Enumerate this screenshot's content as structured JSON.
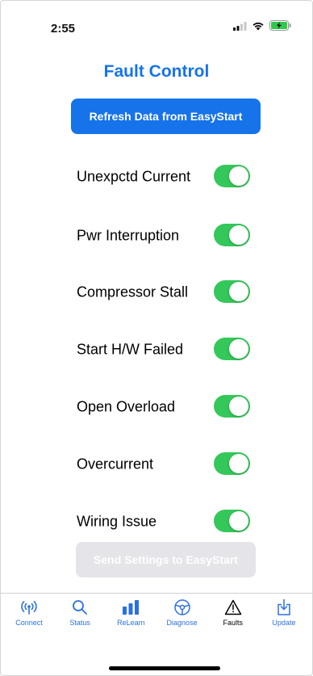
{
  "status_bar": {
    "time": "2:55",
    "icons": [
      "cellular-signal-icon",
      "wifi-icon",
      "battery-charging-icon"
    ],
    "battery_color": "#30c94a"
  },
  "title": "Fault Control",
  "colors": {
    "accent": "#1673ea",
    "toggle_on": "#34c759",
    "disabled_button": "#e4e4e9",
    "tab_inactive": "#2a70e0",
    "tab_active": "#000000"
  },
  "refresh_button": {
    "label": "Refresh Data from EasyStart"
  },
  "faults": [
    {
      "label": "Unexpctd Current",
      "enabled": true
    },
    {
      "label": "Pwr Interruption",
      "enabled": true
    },
    {
      "label": "Compressor Stall",
      "enabled": true
    },
    {
      "label": "Start H/W Failed",
      "enabled": true
    },
    {
      "label": "Open Overload",
      "enabled": true
    },
    {
      "label": "Overcurrent",
      "enabled": true
    },
    {
      "label": "Wiring Issue",
      "enabled": true
    }
  ],
  "send_button": {
    "label": "Send Settings to EasyStart",
    "disabled": true
  },
  "tabs": [
    {
      "label": "Connect",
      "icon": "antenna-icon",
      "active": false
    },
    {
      "label": "Status",
      "icon": "magnifier-icon",
      "active": false
    },
    {
      "label": "ReLearn",
      "icon": "bar-chart-icon",
      "active": false
    },
    {
      "label": "Diagnose",
      "icon": "steering-wheel-icon",
      "active": false
    },
    {
      "label": "Faults",
      "icon": "warning-triangle-icon",
      "active": true
    },
    {
      "label": "Update",
      "icon": "download-tray-icon",
      "active": false
    }
  ]
}
